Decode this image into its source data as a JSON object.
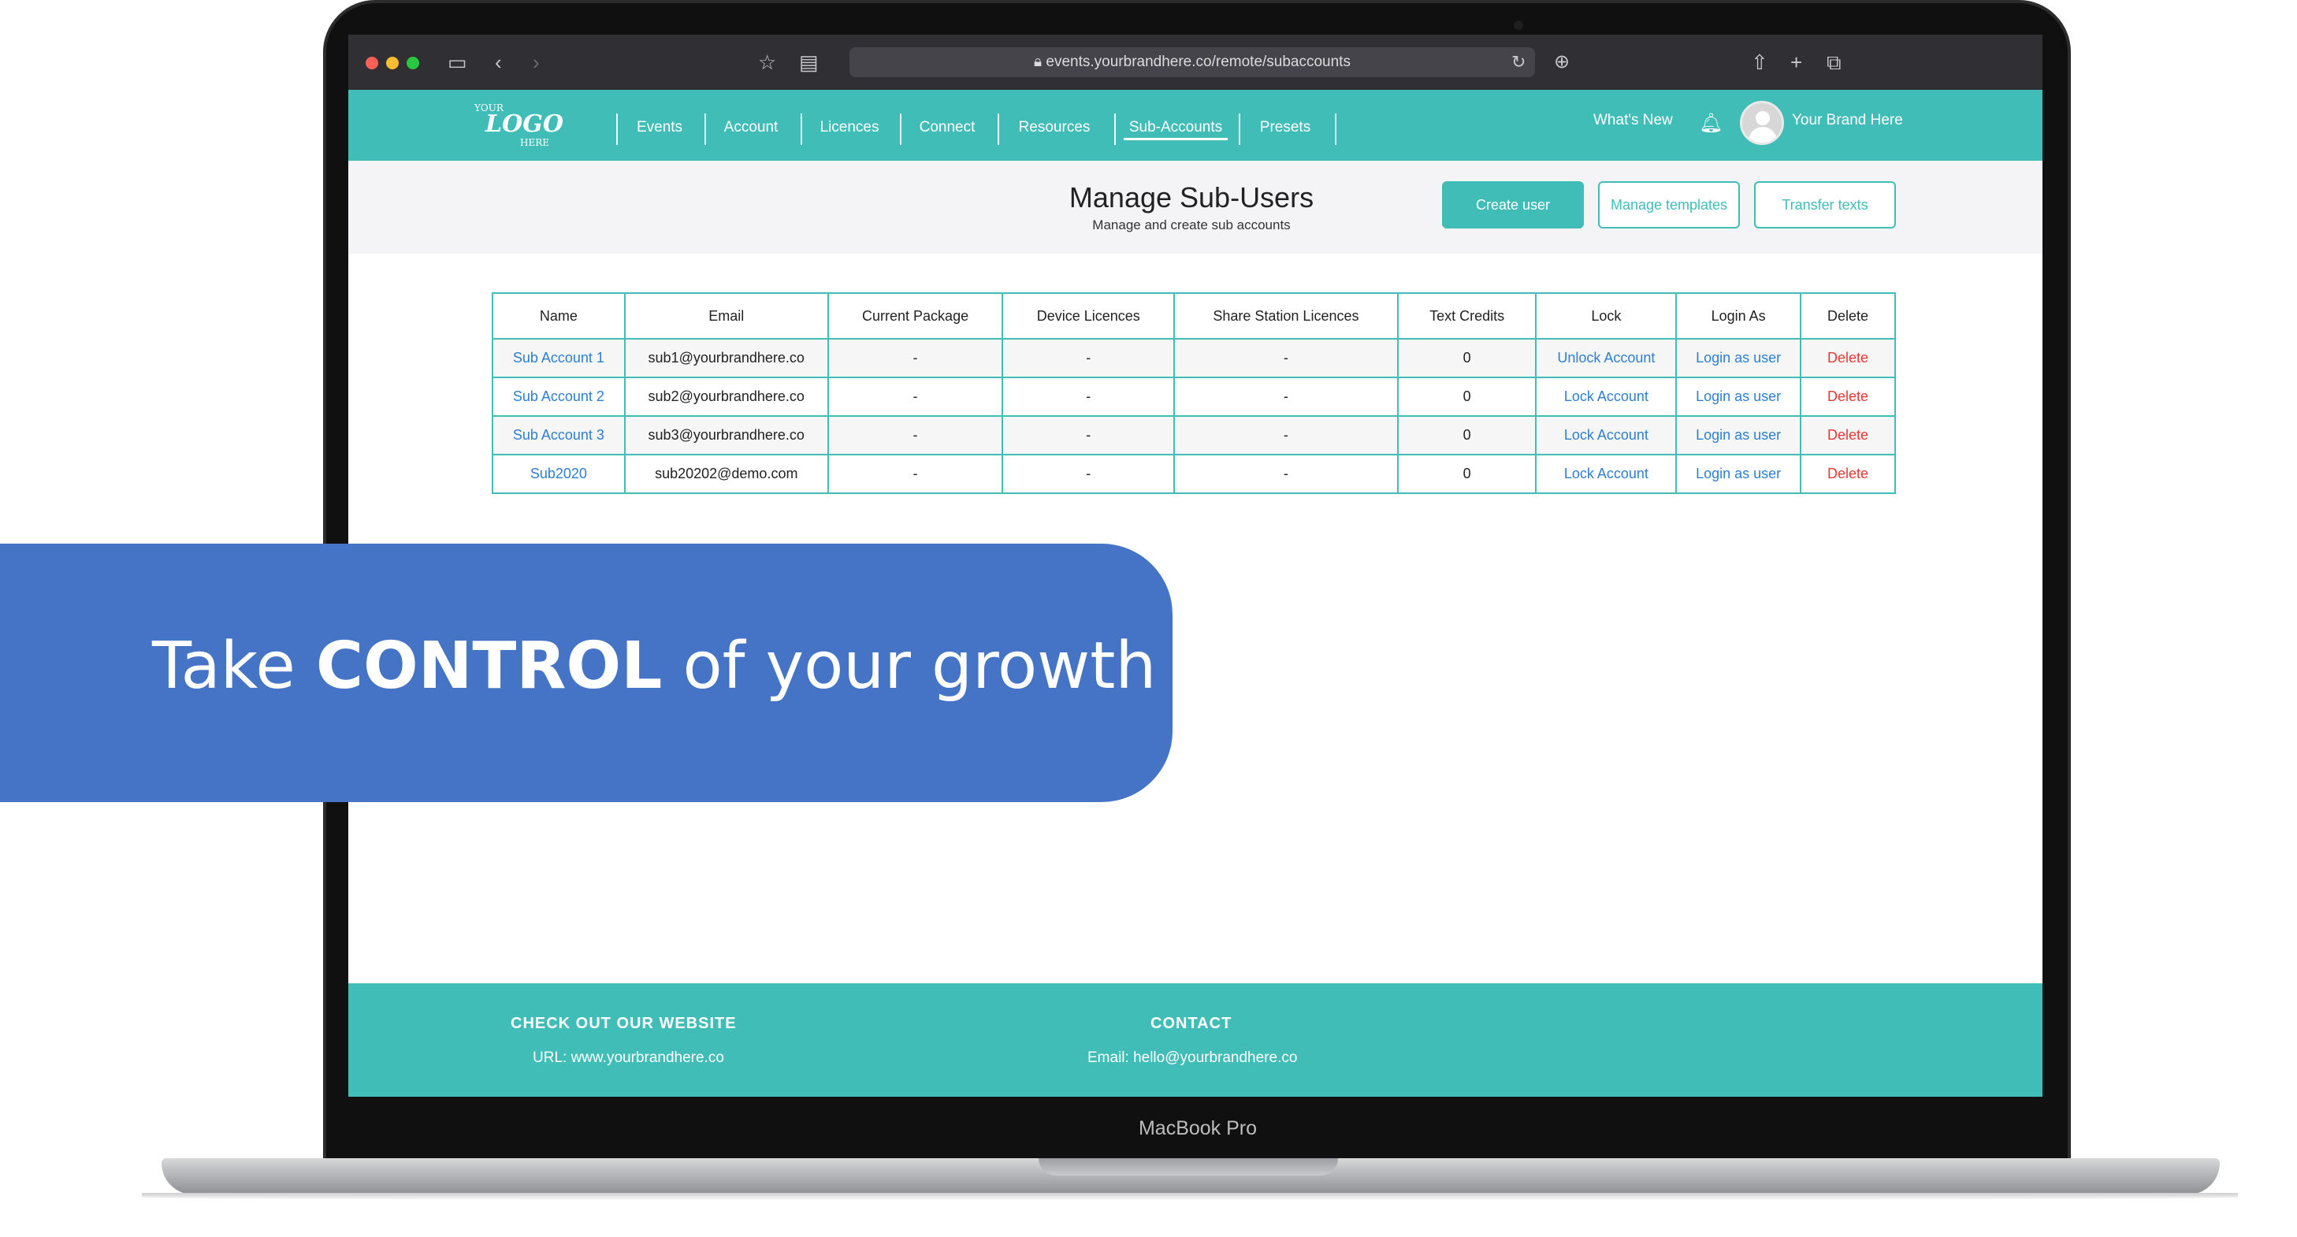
{
  "browser": {
    "url": "events.yourbrandhere.co/remote/subaccounts",
    "icons": [
      "sidebar-icon",
      "back-icon",
      "forward-icon",
      "bookmark-star-icon",
      "reader-icon",
      "lock-icon",
      "reload-icon",
      "download-icon",
      "share-icon",
      "new-tab-icon",
      "tabs-icon"
    ]
  },
  "device_label": "MacBook Pro",
  "nav": {
    "logo_top": "YOUR",
    "logo_main": "LOGO",
    "logo_bottom": "HERE",
    "items": [
      {
        "label": "Events"
      },
      {
        "label": "Account"
      },
      {
        "label": "Licences"
      },
      {
        "label": "Connect"
      },
      {
        "label": "Resources"
      },
      {
        "label": "Sub-Accounts",
        "active": true
      },
      {
        "label": "Presets"
      }
    ],
    "whats_new": "What's New",
    "user_name": "Your Brand Here"
  },
  "page": {
    "title": "Manage Sub-Users",
    "subtitle": "Manage and create sub accounts",
    "buttons": {
      "create": "Create user",
      "templates": "Manage templates",
      "transfer": "Transfer texts"
    }
  },
  "table": {
    "headers": [
      "Name",
      "Email",
      "Current Package",
      "Device Licences",
      "Share Station Licences",
      "Text Credits",
      "Lock",
      "Login As",
      "Delete"
    ],
    "rows": [
      {
        "name": "Sub Account 1",
        "email": "sub1@yourbrandhere.co",
        "package": "-",
        "device": "-",
        "share": "-",
        "credits": "0",
        "lock": "Unlock Account",
        "login": "Login as user",
        "delete": "Delete"
      },
      {
        "name": "Sub Account 2",
        "email": "sub2@yourbrandhere.co",
        "package": "-",
        "device": "-",
        "share": "-",
        "credits": "0",
        "lock": "Lock Account",
        "login": "Login as user",
        "delete": "Delete"
      },
      {
        "name": "Sub Account 3",
        "email": "sub3@yourbrandhere.co",
        "package": "-",
        "device": "-",
        "share": "-",
        "credits": "0",
        "lock": "Lock Account",
        "login": "Login as user",
        "delete": "Delete"
      },
      {
        "name": "Sub2020",
        "email": "sub20202@demo.com",
        "package": "-",
        "device": "-",
        "share": "-",
        "credits": "0",
        "lock": "Lock Account",
        "login": "Login as user",
        "delete": "Delete"
      }
    ]
  },
  "callout": {
    "before": "Take ",
    "bold": "CONTROL",
    "after": " of your growth"
  },
  "footer": {
    "website_heading": "CHECK OUT OUR WEBSITE",
    "website_text": "URL: www.yourbrandhere.co",
    "contact_heading": "CONTACT",
    "contact_text": "Email: hello@yourbrandhere.co"
  },
  "colors": {
    "accent": "#41bdb8",
    "callout": "#4574c6",
    "link": "#2e7fd0",
    "danger": "#e53935"
  }
}
